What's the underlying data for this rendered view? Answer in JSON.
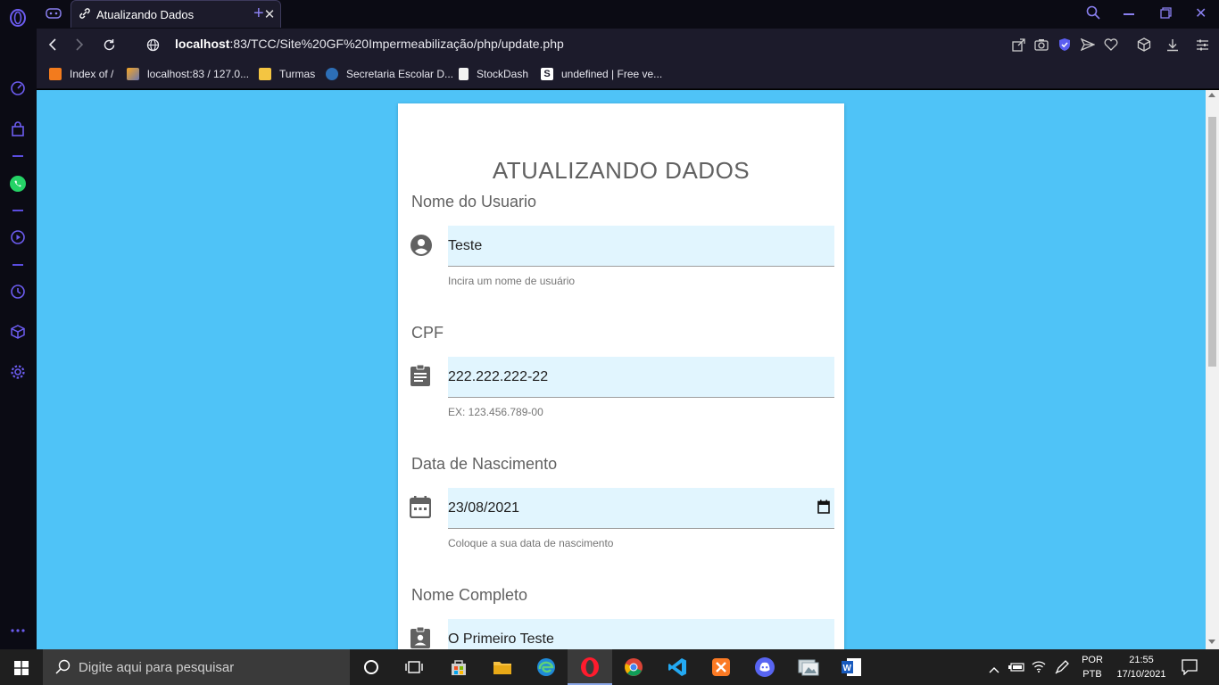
{
  "browser": {
    "tab_title": "Atualizando Dados",
    "url_host": "localhost",
    "url_rest": ":83/TCC/Site%20GF%20Impermeabilização/php/update.php",
    "bookmarks": [
      {
        "label": "Index of /"
      },
      {
        "label": "localhost:83 / 127.0..."
      },
      {
        "label": "Turmas"
      },
      {
        "label": "Secretaria Escolar D..."
      },
      {
        "label": "StockDash"
      },
      {
        "label": "undefined | Free ve..."
      }
    ]
  },
  "form": {
    "title": "ATUALIZANDO DADOS",
    "username": {
      "label": "Nome do Usuario",
      "value": "Teste",
      "helper": "Incira um nome de usuário"
    },
    "cpf": {
      "label": "CPF",
      "value": "222.222.222-22",
      "helper": "EX: 123.456.789-00"
    },
    "birthdate": {
      "label": "Data de Nascimento",
      "value": "23/08/2021",
      "helper": "Coloque a sua data de nascimento"
    },
    "fullname": {
      "label": "Nome Completo",
      "value": "O Primeiro Teste"
    }
  },
  "taskbar": {
    "search_placeholder": "Digite aqui para pesquisar",
    "lang_top": "POR",
    "lang_bottom": "PTB",
    "time": "21:55",
    "date": "17/10/2021"
  },
  "colors": {
    "page_background": "#4fc3f7",
    "field_background": "#e1f5fe",
    "accent": "#5b4de0"
  }
}
